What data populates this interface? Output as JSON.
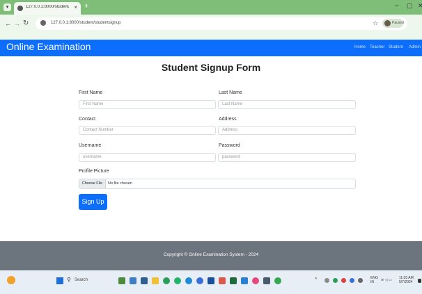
{
  "browser": {
    "tab_title": "127.0.0.1:8000/student/studen",
    "tab_close": "×",
    "new_tab": "+",
    "url": "127.0.0.1:8000/student/studentsignup",
    "profile_label": "Paused",
    "window_minimize": "–",
    "window_maximize": "▢",
    "window_close": "✕"
  },
  "navbar": {
    "brand": "Online Examination",
    "links": [
      "Home",
      "Teacher",
      "Student",
      "Admin"
    ]
  },
  "form": {
    "title": "Student Signup Form",
    "fields": [
      {
        "label": "First Name",
        "placeholder": "First Name"
      },
      {
        "label": "Last Name",
        "placeholder": "Last Name"
      },
      {
        "label": "Contact",
        "placeholder": "Contact Number"
      },
      {
        "label": "Address",
        "placeholder": "Address"
      },
      {
        "label": "Username",
        "placeholder": "username"
      },
      {
        "label": "Password",
        "placeholder": "password"
      }
    ],
    "profile_picture": {
      "label": "Profile Picture",
      "button": "Choose File",
      "status": "No file chosen"
    },
    "submit": "Sign Up"
  },
  "footer": {
    "copyright": "Copyright © Online Examination System - 2024"
  },
  "taskbar": {
    "search_label": "Search",
    "lang_line1": "ENG",
    "lang_line2": "IN",
    "time": "11:03 AM",
    "date": "5/7/2024"
  },
  "colors": {
    "browser_tabbar": "#7fbe79",
    "navbar": "#0d6efd",
    "primary_button": "#0d6efd",
    "footer": "#6c757d"
  }
}
